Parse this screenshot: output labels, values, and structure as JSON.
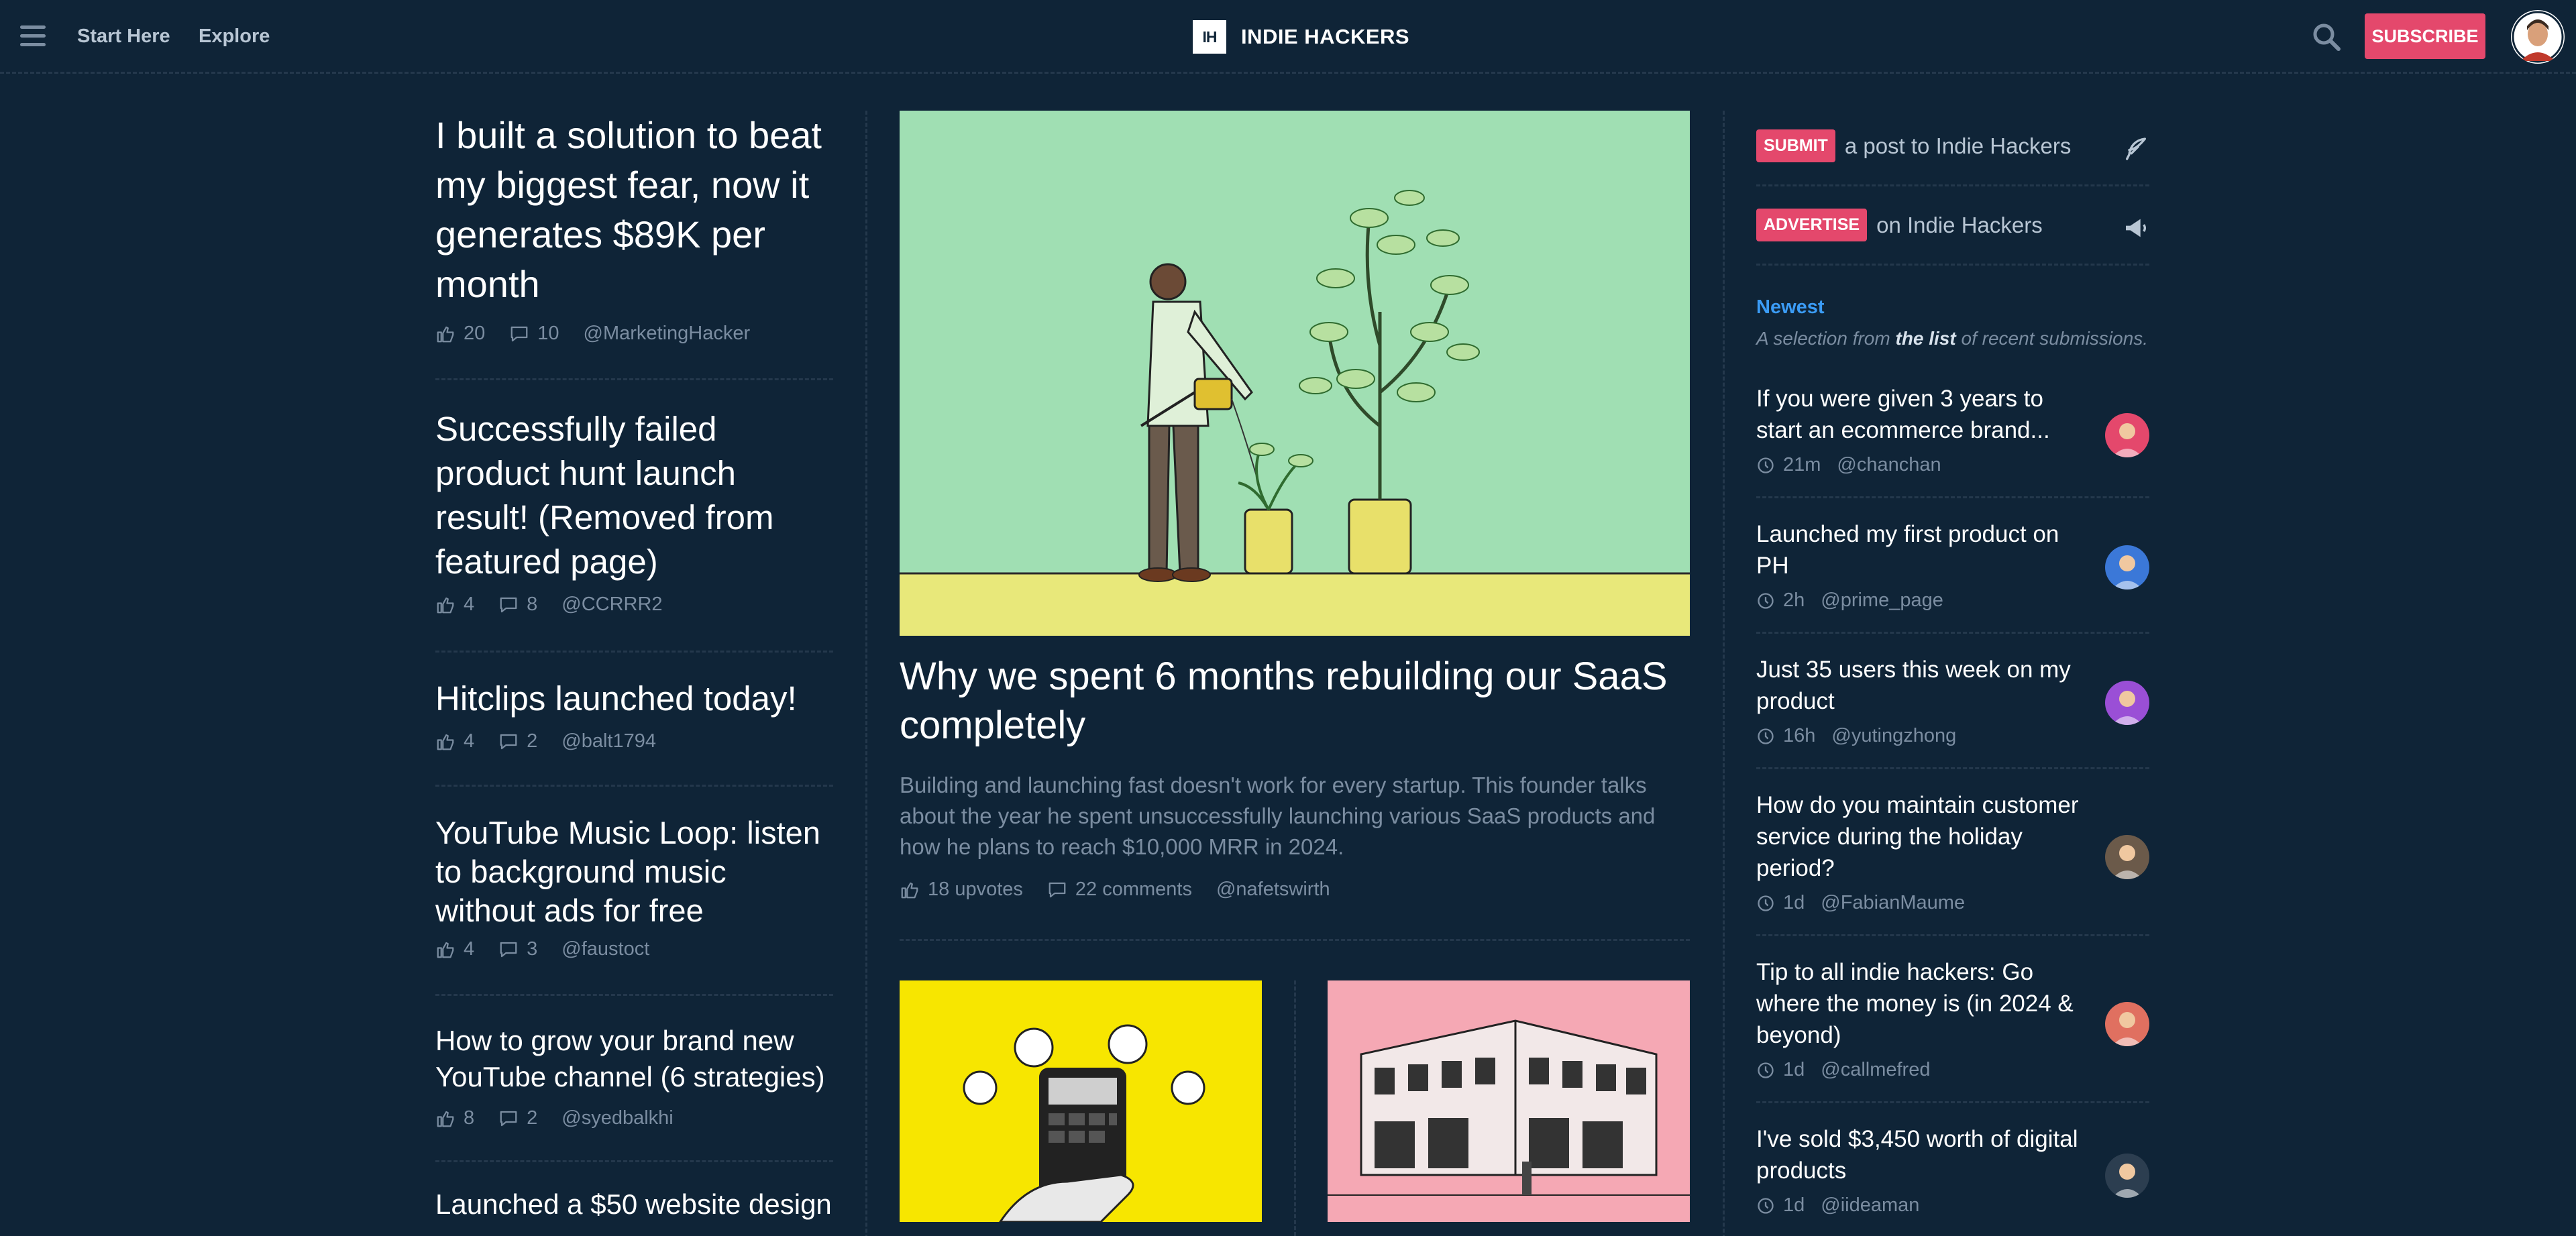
{
  "header": {
    "nav": [
      "Start Here",
      "Explore"
    ],
    "brand_logo": "IH",
    "brand_name": "INDIE HACKERS",
    "subscribe_label": "SUBSCRIBE"
  },
  "left_posts": [
    {
      "title": "I built a solution to beat my biggest fear, now it generates $89K per month",
      "upvotes": "20",
      "comments": "10",
      "author": "@MarketingHacker"
    },
    {
      "title": "Successfully failed product hunt launch result! (Removed from featured page)",
      "upvotes": "4",
      "comments": "8",
      "author": "@CCRRR2"
    },
    {
      "title": "Hitclips launched today!",
      "upvotes": "4",
      "comments": "2",
      "author": "@balt1794"
    },
    {
      "title": "YouTube Music Loop: listen to background music without ads for free",
      "upvotes": "4",
      "comments": "3",
      "author": "@faustoct"
    },
    {
      "title": "How to grow your brand new YouTube channel (6 strategies)",
      "upvotes": "8",
      "comments": "2",
      "author": "@syedbalkhi"
    },
    {
      "title": "Launched a $50 website design"
    }
  ],
  "featured": {
    "title": "Why we spent 6 months rebuilding our SaaS completely",
    "description": "Building and launching fast doesn't work for every startup. This founder talks about the year he spent unsuccessfully launching various SaaS products and how he plans to reach $10,000 MRR in 2024.",
    "upvotes": "18 upvotes",
    "comments": "22 comments",
    "author": "@nafetswirth"
  },
  "sidebar": {
    "submit_badge": "SUBMIT",
    "submit_text": "a post to Indie Hackers",
    "advertise_badge": "ADVERTISE",
    "advertise_text": "on Indie Hackers",
    "newest_heading": "Newest",
    "newest_sub_prefix": "A selection from",
    "newest_sub_link": "the list",
    "newest_sub_suffix": "of recent submissions.",
    "items": [
      {
        "title": "If you were given 3 years to start an ecommerce brand...",
        "time": "21m",
        "author": "@chanchan",
        "avatar_color": "#e4486c"
      },
      {
        "title": "Launched my first product on PH",
        "time": "2h",
        "author": "@prime_page",
        "avatar_color": "#3b78d8"
      },
      {
        "title": "Just 35 users this week on my product",
        "time": "16h",
        "author": "@yutingzhong",
        "avatar_color": "#9a4fd6"
      },
      {
        "title": "How do you maintain customer service during the holiday period?",
        "time": "1d",
        "author": "@FabianMaume",
        "avatar_color": "#6b5a4a"
      },
      {
        "title": "Tip to all indie hackers: Go where the money is (in 2024 & beyond)",
        "time": "1d",
        "author": "@callmefred",
        "avatar_color": "#e07060"
      },
      {
        "title": "I've sold $3,450 worth of digital products",
        "time": "1d",
        "author": "@iideaman",
        "avatar_color": "#2c3e50"
      }
    ]
  }
}
